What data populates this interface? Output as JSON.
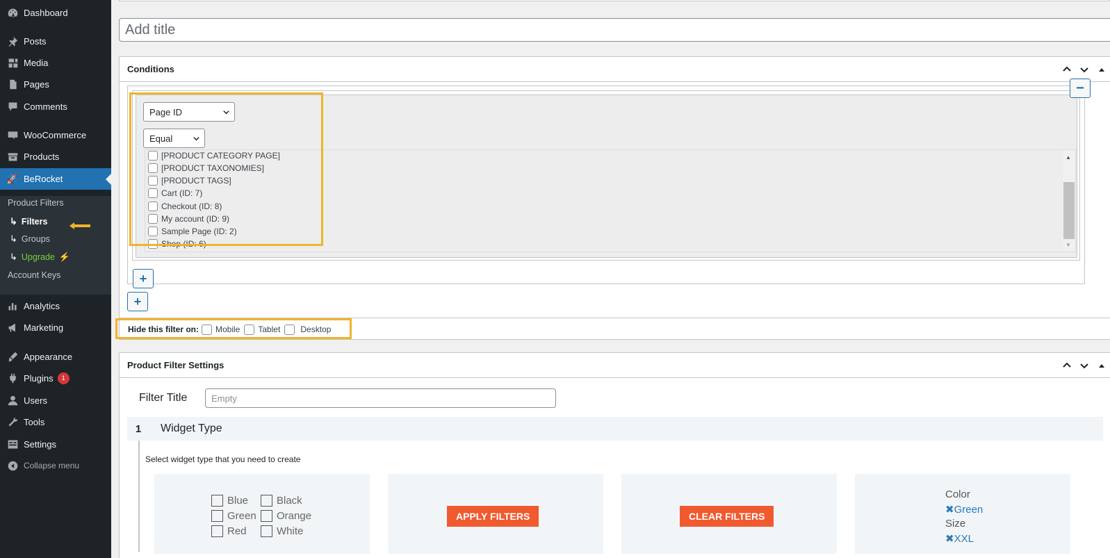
{
  "sidebar": {
    "items": [
      {
        "label": "Dashboard",
        "icon": "dashboard-icon"
      },
      {
        "label": "Posts",
        "icon": "pin-icon"
      },
      {
        "label": "Media",
        "icon": "media-icon"
      },
      {
        "label": "Pages",
        "icon": "pages-icon"
      },
      {
        "label": "Comments",
        "icon": "comment-icon"
      },
      {
        "label": "WooCommerce",
        "icon": "woocommerce-icon"
      },
      {
        "label": "Products",
        "icon": "products-icon"
      },
      {
        "label": "BeRocket",
        "icon": "rocket-icon"
      },
      {
        "label": "Analytics",
        "icon": "analytics-icon"
      },
      {
        "label": "Marketing",
        "icon": "megaphone-icon"
      },
      {
        "label": "Appearance",
        "icon": "brush-icon"
      },
      {
        "label": "Plugins",
        "icon": "plugin-icon",
        "badge": "1"
      },
      {
        "label": "Users",
        "icon": "user-icon"
      },
      {
        "label": "Tools",
        "icon": "wrench-icon"
      },
      {
        "label": "Settings",
        "icon": "settings-icon"
      },
      {
        "label": "Collapse menu",
        "icon": "collapse-icon"
      }
    ],
    "submenu": {
      "product_filters": "Product Filters",
      "filters": "Filters",
      "groups": "Groups",
      "upgrade": "Upgrade",
      "account_keys": "Account Keys",
      "arrow": "↳",
      "bolt": "⚡"
    }
  },
  "title_input": {
    "placeholder": "Add title",
    "value": ""
  },
  "conditions": {
    "title": "Conditions",
    "condition_type": "Page ID",
    "operator": "Equal",
    "options": [
      "[PRODUCT CATEGORY PAGE]",
      "[PRODUCT TAXONOMIES]",
      "[PRODUCT TAGS]",
      "Cart (ID: 7)",
      "Checkout (ID: 8)",
      "My account (ID: 9)",
      "Sample Page (ID: 2)",
      "Shop (ID: 6)"
    ],
    "add_label": "+",
    "remove_label": "−",
    "hide_label": "Hide this filter on:",
    "devices": [
      "Mobile",
      "Tablet",
      "Desktop"
    ]
  },
  "filter_settings": {
    "title": "Product Filter Settings",
    "filter_title_label": "Filter Title",
    "filter_title_placeholder": "Empty",
    "section_number": "1",
    "section_title": "Widget Type",
    "section_desc": "Select widget type that you need to create",
    "card_checkboxes": {
      "col1": [
        "Blue",
        "Green",
        "Red"
      ],
      "col2": [
        "Black",
        "Orange",
        "White"
      ]
    },
    "apply_button": "APPLY FILTERS",
    "clear_button": "CLEAR FILTERS",
    "selected": {
      "color_label": "Color",
      "color_value": "✖Green",
      "size_label": "Size",
      "size_value": "✖XXL"
    }
  },
  "colors": {
    "accent": "#2271b1",
    "highlight": "#f0b429",
    "orange": "#f05a2f",
    "sidebar_bg": "#1d2327"
  }
}
